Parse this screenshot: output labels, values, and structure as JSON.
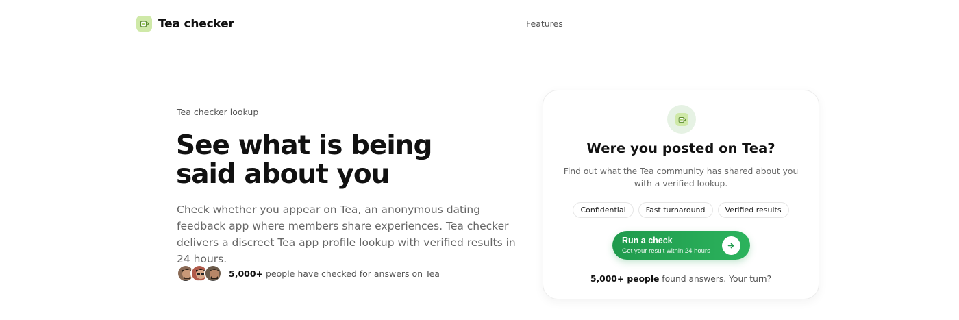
{
  "header": {
    "brand_name": "Tea checker",
    "logo_icon": "cup-icon",
    "nav": [
      {
        "label": "Features"
      }
    ]
  },
  "hero": {
    "eyebrow": "Tea checker lookup",
    "headline_line1": "See what is being",
    "headline_line2_prefix": "said ",
    "headline_line2_highlight": "about you",
    "lede": "Check whether you appear on Tea, an anonymous dating feedback app where members share experiences. Tea checker delivers a discreet Tea app profile lookup with verified results in 24 hours.",
    "social_count": "5,000+",
    "social_text": " people have checked for answers on Tea",
    "avatars": [
      {
        "name": "avatar-1",
        "skin": "#c99878",
        "hair": "#2b1d14"
      },
      {
        "name": "avatar-2",
        "skin": "#d8a98a",
        "hair": "#1c1410"
      },
      {
        "name": "avatar-3",
        "skin": "#b78667",
        "hair": "#33261c"
      }
    ]
  },
  "card": {
    "icon": "cup-icon",
    "title": "Were you posted on Tea?",
    "subtitle": "Find out what the Tea community has shared about you with a verified lookup.",
    "pills": [
      "Confidential",
      "Fast turnaround",
      "Verified results"
    ],
    "cta_label": "Run a check",
    "cta_sub": "Get your result within 24 hours",
    "cta_icon": "arrow-right-icon",
    "footer_count": "5,000+ people",
    "footer_text": " found answers. Your turn?"
  },
  "colors": {
    "accent_green": "#1f9a4c",
    "logo_bg": "#cfe9a8",
    "highlight": "#d4ecd9"
  }
}
